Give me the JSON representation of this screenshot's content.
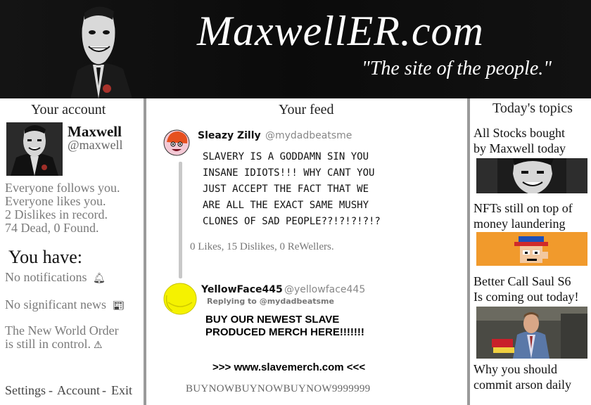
{
  "header": {
    "title": "MaxwellER.com",
    "tagline": "\"The site of the people.\""
  },
  "account": {
    "heading": "Your account",
    "name": "Maxwell",
    "handle": "@maxwell",
    "stats": [
      "Everyone follows you.",
      "Everyone likes you.",
      "2 Dislikes in record.",
      "74 Dead, 0 Found."
    ],
    "you_have": "You have:",
    "notices": {
      "notifications": "No notifications",
      "news": "No significant news",
      "nwo_line1": "The New World Order",
      "nwo_line2": "is still in control."
    },
    "footer": {
      "settings": "Settings",
      "sep1": "-",
      "account": "Account",
      "sep2": "-",
      "exit": "Exit"
    }
  },
  "feed": {
    "heading": "Your feed",
    "posts": [
      {
        "author": "Sleazy Zilly",
        "handle": "@mydadbeatsme",
        "lines": [
          "SLAVERY IS A GODDAMN SIN YOU",
          "INSANE IDIOTS!!! WHY CANT YOU",
          "JUST ACCEPT THE FACT THAT WE",
          "ARE ALL THE EXACT SAME MUSHY",
          "CLONES OF SAD PEOPLE??!?!?!?!?"
        ],
        "stats": "0 Likes, 15 Dislikes, 0 ReWellers."
      },
      {
        "author": "YellowFace445",
        "handle": "@yellowface445",
        "replying": "Replying to @mydadbeatsme",
        "lines": [
          "BUY OUR NEWEST SLAVE",
          "PRODUCED MERCH HERE!!!!!!!"
        ],
        "link": ">>> www.slavemerch.com <<<"
      }
    ],
    "footer": "BUYNOWBUYNOWBUYNOW9999999"
  },
  "topics": {
    "heading": "Today's topics",
    "items": [
      {
        "line1": "All Stocks bought",
        "line2": "by Maxwell today"
      },
      {
        "line1": "NFTs still on top of",
        "line2": "money laundering"
      },
      {
        "line1": "Better Call Saul S6",
        "line2": "Is coming out today!"
      },
      {
        "line1": "Why you should",
        "line2": "commit arson daily"
      }
    ]
  },
  "icons": {
    "notifications": "bell-icon",
    "news": "newspaper-icon",
    "nwo": "warning-icon"
  },
  "colors": {
    "header_bg": "#111111",
    "muted_text": "#7a7a7a",
    "divider": "#9a9a9a",
    "thread_line": "#c8c8c8",
    "yellow_avatar": "#f5f200",
    "orange_avatar": "#e6501e",
    "nft_bg": "#f19a2c"
  }
}
